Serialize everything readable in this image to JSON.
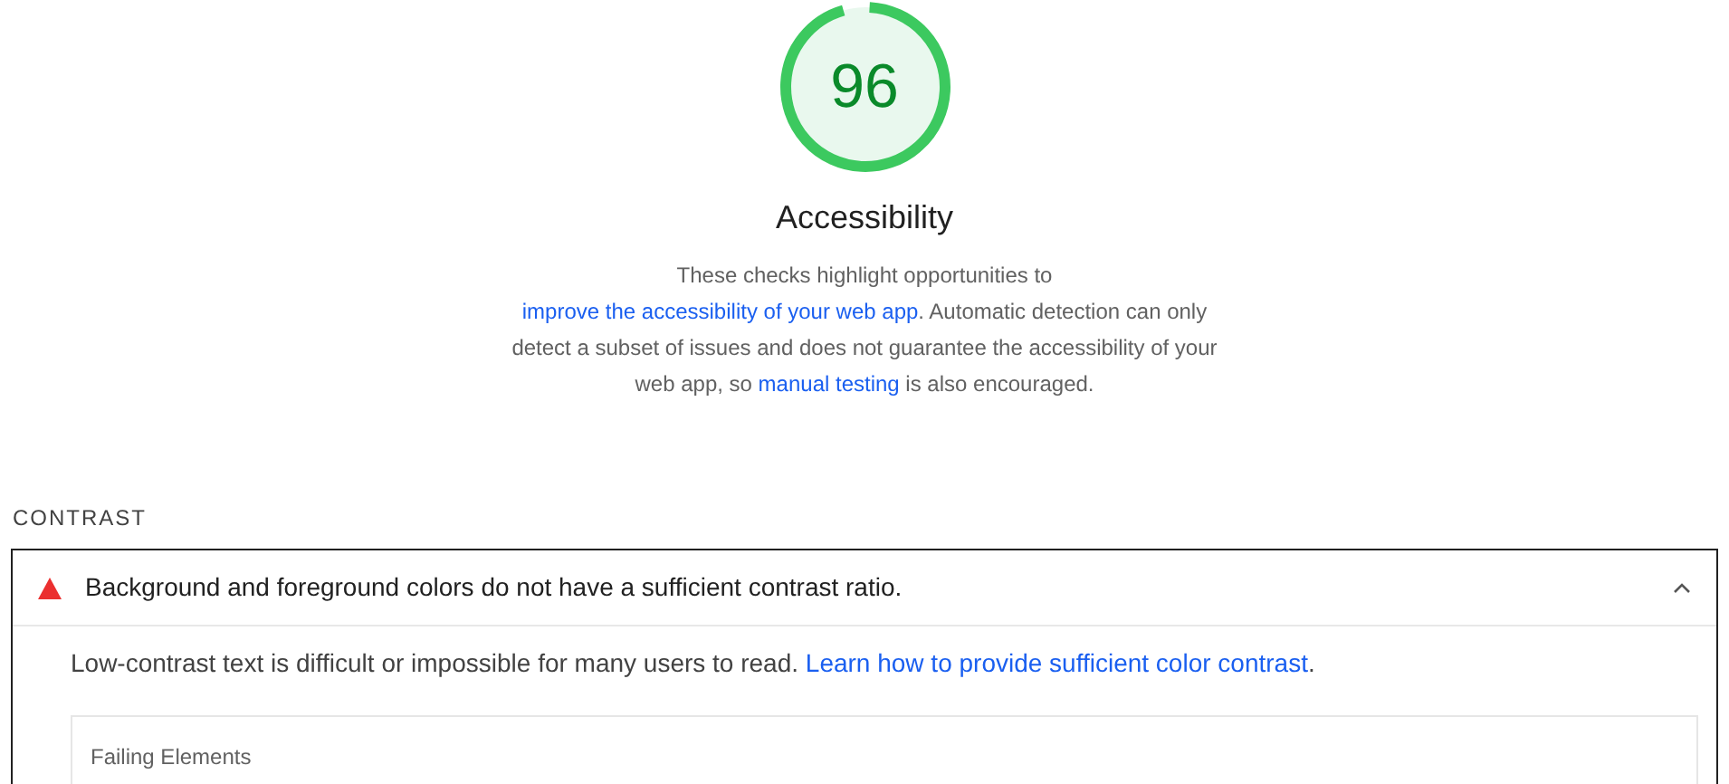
{
  "gauge": {
    "score": "96",
    "level": 0.96
  },
  "category": {
    "title": "Accessibility",
    "description": [
      {
        "kind": "text",
        "text": "These checks highlight opportunities to "
      },
      {
        "kind": "link",
        "text": "improve the accessibility of your web app"
      },
      {
        "kind": "text",
        "text": ". Automatic detection can only detect a subset of issues and does not guarantee the accessibility of your web app, so "
      },
      {
        "kind": "link",
        "text": "manual testing"
      },
      {
        "kind": "text",
        "text": " is also encouraged."
      }
    ]
  },
  "section": {
    "title": "CONTRAST"
  },
  "audits": [
    {
      "title": "Background and foreground colors do not have a sufficient contrast ratio.",
      "expanded": true,
      "description": [
        {
          "kind": "text",
          "text": "Low-contrast text is difficult or impossible for many users to read. "
        },
        {
          "kind": "link",
          "text": "Learn how to provide sufficient color contrast"
        },
        {
          "kind": "text",
          "text": "."
        }
      ],
      "details_title": "Failing Elements"
    }
  ]
}
